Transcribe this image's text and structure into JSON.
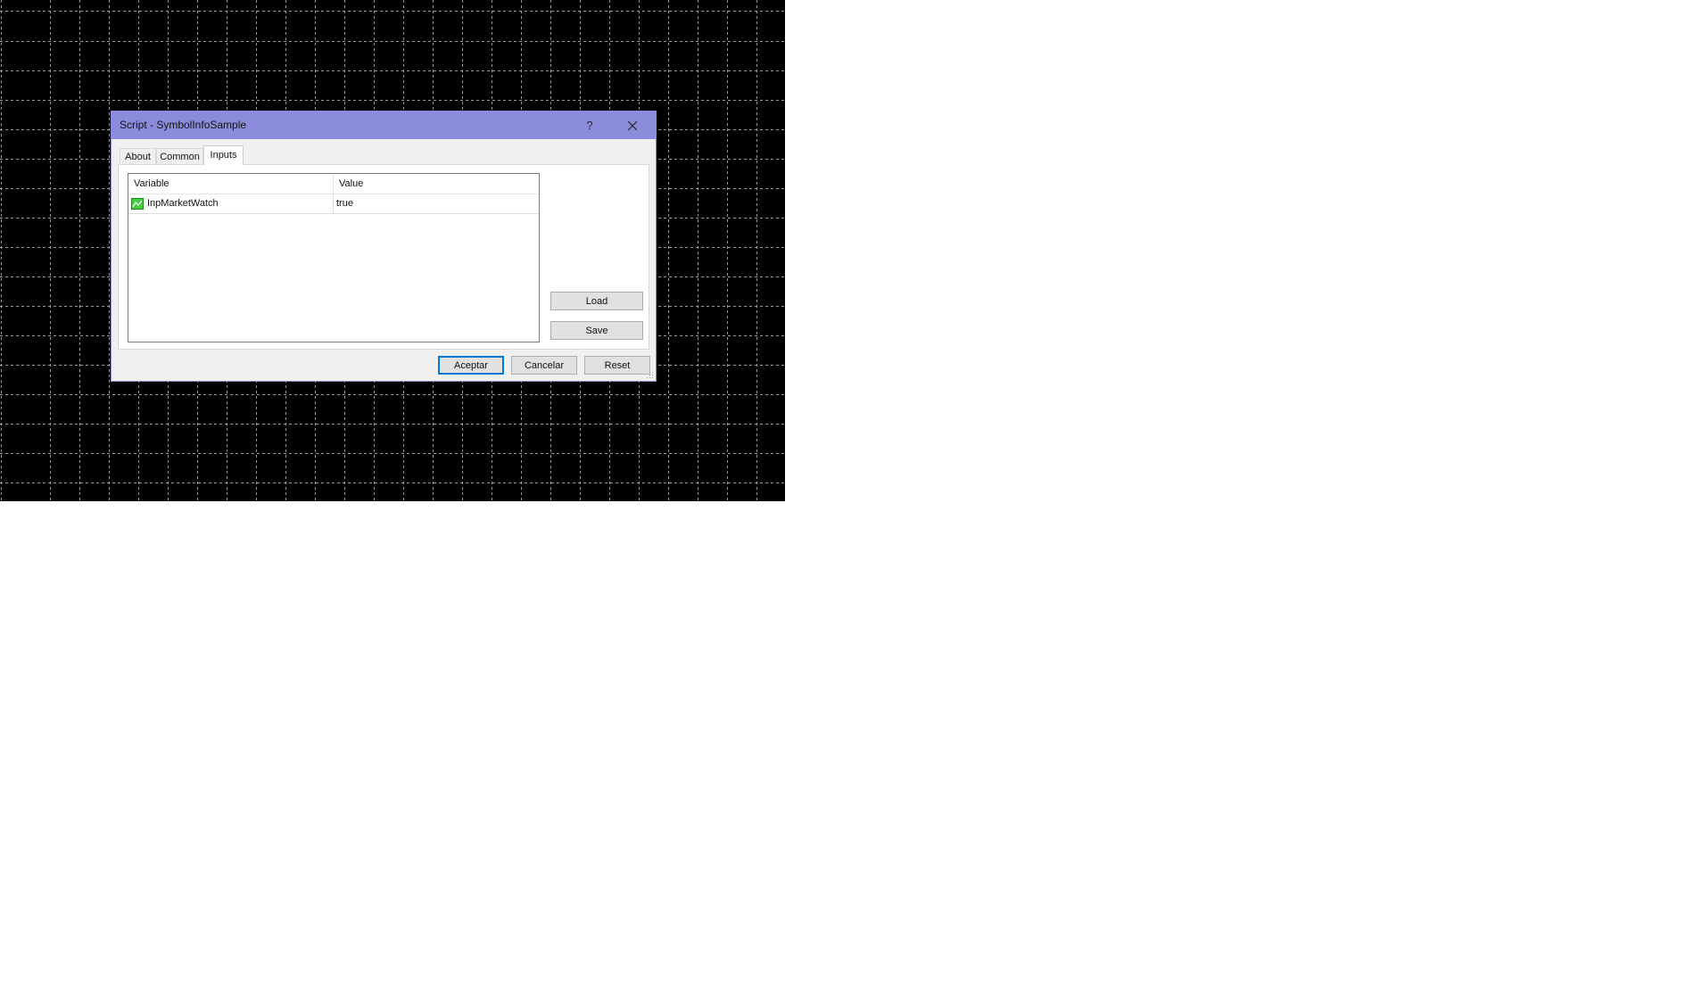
{
  "dialog": {
    "title": "Script - SymbolInfoSample",
    "help_glyph": "?",
    "close_glyph": "✕"
  },
  "tabs": [
    {
      "label": "About"
    },
    {
      "label": "Common"
    },
    {
      "label": "Inputs",
      "selected": true
    }
  ],
  "inputs_table": {
    "columns": [
      "Variable",
      "Value"
    ],
    "rows": [
      {
        "variable": "InpMarketWatch",
        "value": "true",
        "icon": "bool-parameter-icon"
      }
    ]
  },
  "side_buttons": {
    "load": "Load",
    "save": "Save"
  },
  "footer_buttons": {
    "ok": "Aceptar",
    "cancel": "Cancelar",
    "reset": "Reset"
  },
  "colors": {
    "titlebar": "#8c8cdc",
    "chart_background": "#000000",
    "grid": "#9a9a9a",
    "focus_border": "#0078d7"
  }
}
